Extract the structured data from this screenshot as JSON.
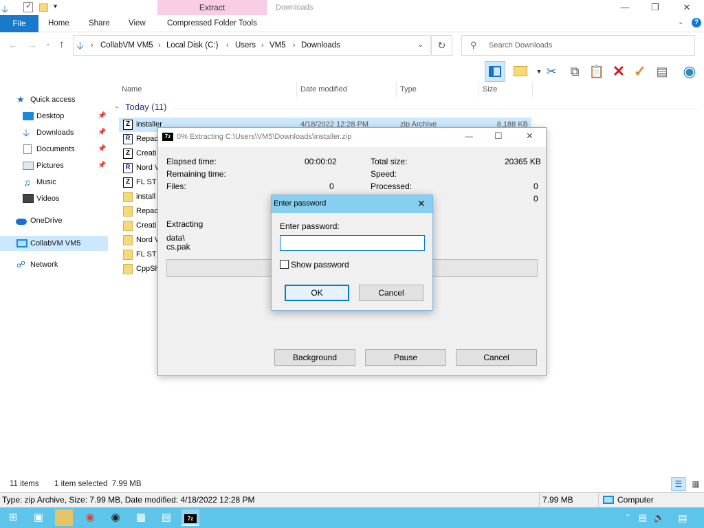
{
  "window": {
    "context_tab": "Extract",
    "title": "Downloads"
  },
  "ribbon": {
    "file": "File",
    "tabs": [
      "Home",
      "Share",
      "View",
      "Compressed Folder Tools"
    ]
  },
  "address": {
    "crumbs": [
      "CollabVM VM5",
      "Local Disk (C:)",
      "Users",
      "VM5",
      "Downloads"
    ],
    "search_placeholder": "Search Downloads"
  },
  "nav": {
    "items": [
      {
        "label": "Quick access",
        "icon": "star-icon"
      },
      {
        "label": "Desktop",
        "icon": "desktop-icon",
        "pinned": true
      },
      {
        "label": "Downloads",
        "icon": "download-icon",
        "pinned": true
      },
      {
        "label": "Documents",
        "icon": "document-icon",
        "pinned": true
      },
      {
        "label": "Pictures",
        "icon": "pictures-icon",
        "pinned": true
      },
      {
        "label": "Music",
        "icon": "music-icon"
      },
      {
        "label": "Videos",
        "icon": "videos-icon"
      },
      {
        "label": "OneDrive",
        "icon": "cloud-icon"
      },
      {
        "label": "CollabVM VM5",
        "icon": "computer-icon"
      },
      {
        "label": "Network",
        "icon": "network-icon"
      }
    ]
  },
  "columns": {
    "name": "Name",
    "date": "Date modified",
    "type": "Type",
    "size": "Size"
  },
  "group": "Today (11)",
  "files": [
    {
      "name": "installer",
      "date": "4/18/2022 12:28 PM",
      "type": "zip Archive",
      "size": "8,188 KB",
      "icon": "7z"
    },
    {
      "name": "Repac",
      "icon": "r"
    },
    {
      "name": "Creati",
      "icon": "7z"
    },
    {
      "name": "Nord V",
      "icon": "r"
    },
    {
      "name": "FL ST",
      "icon": "7z"
    },
    {
      "name": "install",
      "icon": "folder"
    },
    {
      "name": "Repac",
      "icon": "folder"
    },
    {
      "name": "Creati",
      "icon": "folder"
    },
    {
      "name": "Nord V",
      "icon": "folder"
    },
    {
      "name": "FL ST",
      "icon": "folder"
    },
    {
      "name": "CppSh",
      "icon": "folder"
    }
  ],
  "extract_dialog": {
    "title": "0% Extracting C:\\Users\\VM5\\Downloads\\installer.zip",
    "elapsed_label": "Elapsed time:",
    "elapsed_value": "00:00:02",
    "remaining_label": "Remaining time:",
    "files_label": "Files:",
    "files_value": "0",
    "total_size_label": "Total size:",
    "total_size_value": "20365 KB",
    "speed_label": "Speed:",
    "processed_label": "Processed:",
    "processed_value": "0",
    "extra_value": "0",
    "extracting_label": "Extracting",
    "path_line1": "data\\",
    "path_line2": "cs.pak",
    "progress": 0,
    "btn_background": "Background",
    "btn_pause": "Pause",
    "btn_cancel": "Cancel"
  },
  "password_dialog": {
    "title": "Enter password",
    "prompt": "Enter password:",
    "value": "",
    "show_password": "Show password",
    "ok": "OK",
    "cancel": "Cancel"
  },
  "status": {
    "items_count": "11 items",
    "selected": "1 item selected  7.99 MB",
    "info": "Type: zip Archive, Size: 7.99 MB, Date modified: 4/18/2022 12:28 PM",
    "size": "7.99 MB",
    "location": "Computer"
  },
  "colors": {
    "accent": "#1979ca",
    "taskbar": "#5ec5ea",
    "context_tab": "#f9cde3",
    "dialog_title": "#87cff0"
  }
}
